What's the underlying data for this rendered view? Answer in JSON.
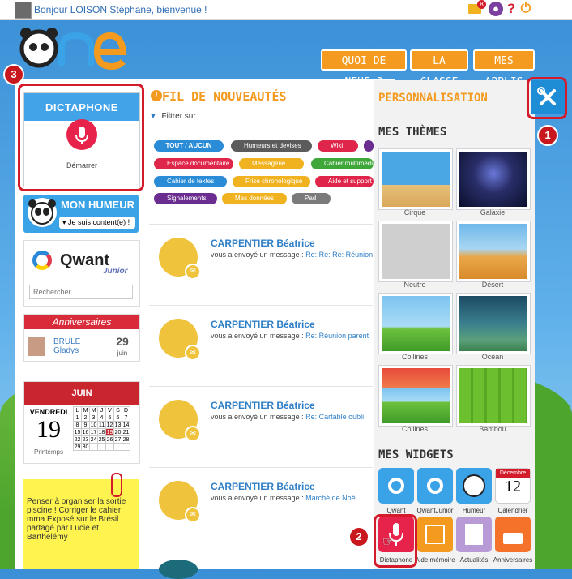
{
  "topbar": {
    "greeting": "Bonjour LOISON Stéphane, bienvenue !",
    "mail_count": "8",
    "icons": [
      "mail-icon",
      "user-icon",
      "help-icon",
      "power-icon"
    ]
  },
  "logo": {
    "text": "One"
  },
  "nav": {
    "quoi_de_neuf": "QUOI DE NEUF ?",
    "la_classe": "LA CLASSE",
    "mes_applis": "MES APPLIS"
  },
  "callouts": {
    "one": "1",
    "two": "2",
    "three": "3"
  },
  "dictaphone": {
    "title": "DICTAPHONE",
    "action": "Démarrer"
  },
  "humeur": {
    "title": "MON HUMEUR",
    "value": "Je suis content(e) !"
  },
  "qwant": {
    "brand": "Qwant",
    "sub": "Junior",
    "placeholder": "Rechercher"
  },
  "anniversaires": {
    "title": "Anniversaires",
    "first": "BRULE",
    "last": "Gladys",
    "day": "29",
    "month": "juin"
  },
  "calendar": {
    "month": "JUIN",
    "weekday": "VENDREDI",
    "day": "19",
    "season": "Printemps",
    "headers": [
      "L",
      "M",
      "M",
      "J",
      "V",
      "S",
      "D"
    ],
    "rows": [
      [
        "1",
        "2",
        "3",
        "4",
        "5",
        "6",
        "7"
      ],
      [
        "8",
        "9",
        "10",
        "11",
        "12",
        "13",
        "14"
      ],
      [
        "15",
        "16",
        "17",
        "18",
        "19",
        "20",
        "21"
      ],
      [
        "22",
        "23",
        "24",
        "25",
        "26",
        "27",
        "28"
      ],
      [
        "29",
        "30",
        "",
        "",
        "",
        "",
        ""
      ]
    ]
  },
  "postit": {
    "text": "Penser à organiser la sortie piscine ! Corriger le cahier mma Exposé sur le Brésil partagé par Lucie et Barthélémy"
  },
  "fil": {
    "title": "FIL DE NOUVEAUTÉS",
    "filter_label": "Filtrer sur",
    "tags": [
      {
        "label": "TOUT / AUCUN",
        "color": "#2a8bd7"
      },
      {
        "label": "Humeurs et devises",
        "color": "#5b5b5b"
      },
      {
        "label": "Wiki",
        "color": "#e0254a"
      },
      {
        "label": "Espace documentaire",
        "color": "#e0254a"
      },
      {
        "label": "Messagerie",
        "color": "#f0b21f"
      },
      {
        "label": "Cahier multimédia",
        "color": "#3fa63a"
      },
      {
        "label": "Cahier de textes",
        "color": "#2a8bd7"
      },
      {
        "label": "Frise chronologique",
        "color": "#f0b21f"
      },
      {
        "label": "Aide et support",
        "color": "#e0254a"
      },
      {
        "label": "Signalements",
        "color": "#6b2d8f"
      },
      {
        "label": "Mes données",
        "color": "#f0b21f"
      },
      {
        "label": "Pad",
        "color": "#7a7a7a"
      }
    ],
    "items": [
      {
        "name": "CARPENTIER Béatrice",
        "prefix": "vous a envoyé un message : ",
        "subject": "Re: Re: Re: Réunion"
      },
      {
        "name": "CARPENTIER Béatrice",
        "prefix": "vous a envoyé un message : ",
        "subject": "Re: Réunion parent"
      },
      {
        "name": "CARPENTIER Béatrice",
        "prefix": "vous a envoyé un message : ",
        "subject": "Re: Cartable oubli"
      },
      {
        "name": "CARPENTIER Béatrice",
        "prefix": "vous a envoyé un message : ",
        "subject": "Marché de Noël."
      }
    ]
  },
  "perso": {
    "title": "PERSONNALISATION",
    "themes_title": "MES THÈMES",
    "themes": [
      "Cirque",
      "Galaxie",
      "Neutre",
      "Désert",
      "Collines",
      "Océan",
      "Collines",
      "Bambou"
    ],
    "widgets_title": "MES WIDGETS",
    "widgets": [
      {
        "label": "Qwant",
        "color": "#3aa2e6"
      },
      {
        "label": "QwantJunior",
        "color": "#3aa2e6"
      },
      {
        "label": "Humeur",
        "color": "#3aa2e6"
      },
      {
        "label": "Calendrier",
        "color": "#ffffff"
      },
      {
        "label": "Dictaphone",
        "color": "#e8234b"
      },
      {
        "label": "Aide mémoire",
        "color": "#f39a1f"
      },
      {
        "label": "Actualités",
        "color": "#b89ad6"
      },
      {
        "label": "Anniversaires",
        "color": "#f5722a"
      }
    ],
    "calendrier_tile": {
      "month": "Décembre",
      "day": "12"
    }
  }
}
